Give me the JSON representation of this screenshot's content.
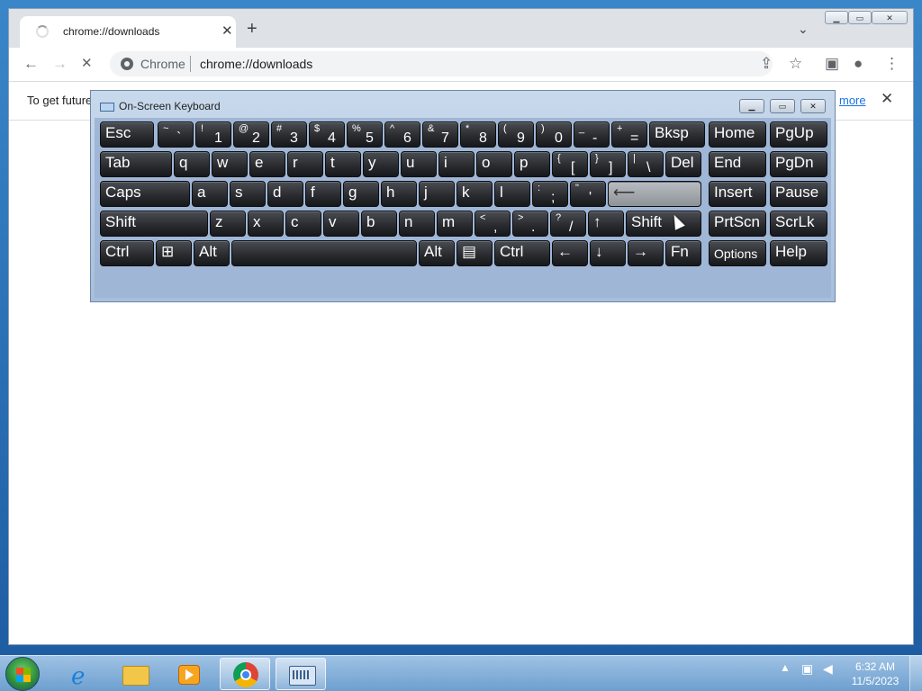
{
  "browser": {
    "tab_title": "chrome://downloads",
    "tab_close": "✕",
    "new_tab": "+",
    "tab_search": "⌄",
    "site_label": "Chrome",
    "url": "chrome://downloads",
    "back": "←",
    "forward": "→",
    "reload": "✕",
    "share": "⇪",
    "star": "☆",
    "side_panel": "▣",
    "profile": "●",
    "menu": "⋮",
    "window_min": "▁",
    "window_max": "▭",
    "window_close": "✕"
  },
  "infobar": {
    "text": "To get future",
    "link": "more",
    "close": "✕"
  },
  "osk": {
    "title": "On-Screen Keyboard",
    "min": "▁",
    "restore": "▭",
    "close": "✕",
    "rows": [
      [
        {
          "label": "Esc"
        },
        {
          "shift": "~",
          "primary": "`"
        },
        {
          "shift": "!",
          "primary": "1"
        },
        {
          "shift": "@",
          "primary": "2"
        },
        {
          "shift": "#",
          "primary": "3"
        },
        {
          "shift": "$",
          "primary": "4"
        },
        {
          "shift": "%",
          "primary": "5"
        },
        {
          "shift": "^",
          "primary": "6"
        },
        {
          "shift": "&",
          "primary": "7"
        },
        {
          "shift": "*",
          "primary": "8"
        },
        {
          "shift": "(",
          "primary": "9"
        },
        {
          "shift": ")",
          "primary": "0"
        },
        {
          "shift": "_",
          "primary": "-"
        },
        {
          "shift": "+",
          "primary": "="
        },
        {
          "label": "Bksp"
        },
        {
          "label": "Home"
        },
        {
          "label": "PgUp"
        }
      ],
      [
        {
          "label": "Tab"
        },
        {
          "label": "q"
        },
        {
          "label": "w"
        },
        {
          "label": "e"
        },
        {
          "label": "r"
        },
        {
          "label": "t"
        },
        {
          "label": "y"
        },
        {
          "label": "u"
        },
        {
          "label": "i"
        },
        {
          "label": "o"
        },
        {
          "label": "p"
        },
        {
          "shift": "{",
          "primary": "["
        },
        {
          "shift": "}",
          "primary": "]"
        },
        {
          "shift": "|",
          "primary": "\\"
        },
        {
          "label": "Del"
        },
        {
          "label": "End"
        },
        {
          "label": "PgDn"
        }
      ],
      [
        {
          "label": "Caps"
        },
        {
          "label": "a"
        },
        {
          "label": "s"
        },
        {
          "label": "d"
        },
        {
          "label": "f"
        },
        {
          "label": "g"
        },
        {
          "label": "h"
        },
        {
          "label": "j"
        },
        {
          "label": "k"
        },
        {
          "label": "l"
        },
        {
          "shift": ":",
          "primary": ";"
        },
        {
          "shift": "\"",
          "primary": "'"
        },
        {
          "label": "⟵"
        },
        {
          "label": "Insert"
        },
        {
          "label": "Pause"
        }
      ],
      [
        {
          "label": "Shift"
        },
        {
          "label": "z"
        },
        {
          "label": "x"
        },
        {
          "label": "c"
        },
        {
          "label": "v"
        },
        {
          "label": "b"
        },
        {
          "label": "n"
        },
        {
          "label": "m"
        },
        {
          "shift": "<",
          "primary": ","
        },
        {
          "shift": ">",
          "primary": "."
        },
        {
          "shift": "?",
          "primary": "/"
        },
        {
          "label": "↑"
        },
        {
          "label": "Shift"
        },
        {
          "label": "PrtScn"
        },
        {
          "label": "ScrLk"
        }
      ],
      [
        {
          "label": "Ctrl"
        },
        {
          "label": "⊞"
        },
        {
          "label": "Alt"
        },
        {
          "label": ""
        },
        {
          "label": "Alt"
        },
        {
          "label": "▤"
        },
        {
          "label": "Ctrl"
        },
        {
          "label": "←"
        },
        {
          "label": "↓"
        },
        {
          "label": "→"
        },
        {
          "label": "Fn"
        },
        {
          "label": "Options"
        },
        {
          "label": "Help"
        }
      ]
    ]
  },
  "taskbar": {
    "tray_arrow": "▲",
    "time": "6:32 AM",
    "date": "11/5/2023",
    "ie_glyph": "e"
  }
}
